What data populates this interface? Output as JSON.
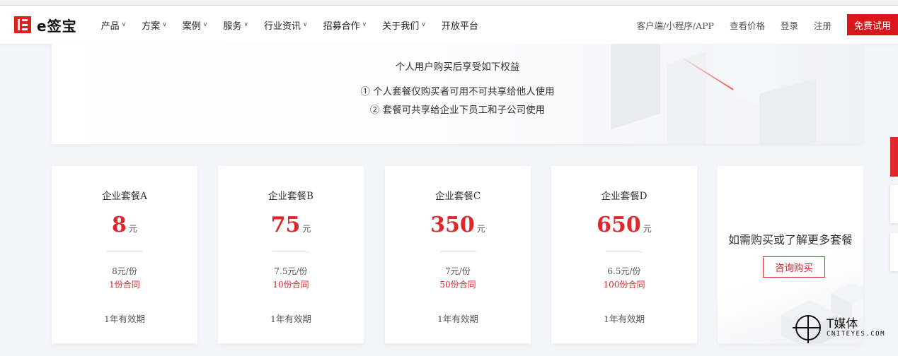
{
  "header": {
    "logo_text": "e签宝",
    "nav": [
      {
        "label": "产品",
        "has_dropdown": true
      },
      {
        "label": "方案",
        "has_dropdown": true
      },
      {
        "label": "案例",
        "has_dropdown": true
      },
      {
        "label": "服务",
        "has_dropdown": true
      },
      {
        "label": "行业资讯",
        "has_dropdown": true
      },
      {
        "label": "招募合作",
        "has_dropdown": true
      },
      {
        "label": "关于我们",
        "has_dropdown": true
      },
      {
        "label": "开放平台",
        "has_dropdown": false
      }
    ],
    "right_links": {
      "client": "客户端/小程序/APP",
      "pricing": "查看价格",
      "login": "登录",
      "register": "注册"
    },
    "trial_button": "免费试用"
  },
  "benefits": {
    "title": "个人用户购买后享受如下权益",
    "items": [
      "① 个人套餐仅购买者可用不可共享给他人使用",
      "② 套餐可共享给企业下员工和子公司使用"
    ]
  },
  "packages": [
    {
      "name": "企业套餐A",
      "price": "8",
      "unit": "元",
      "unit_price": "8元/份",
      "count": "1份合同",
      "validity": "1年有效期"
    },
    {
      "name": "企业套餐B",
      "price": "75",
      "unit": "元",
      "unit_price": "7.5元/份",
      "count": "10份合同",
      "validity": "1年有效期"
    },
    {
      "name": "企业套餐C",
      "price": "350",
      "unit": "元",
      "unit_price": "7元/份",
      "count": "50份合同",
      "validity": "1年有效期"
    },
    {
      "name": "企业套餐D",
      "price": "650",
      "unit": "元",
      "unit_price": "6.5元/份",
      "count": "100份合同",
      "validity": "1年有效期"
    }
  ],
  "more": {
    "text": "如需购买或了解更多套餐",
    "button": "咨询购买"
  },
  "watermark": {
    "title": "T媒体",
    "subtitle": "CNITEYES.COM"
  },
  "colors": {
    "accent": "#e0252c",
    "background": "#f3f5f9"
  }
}
